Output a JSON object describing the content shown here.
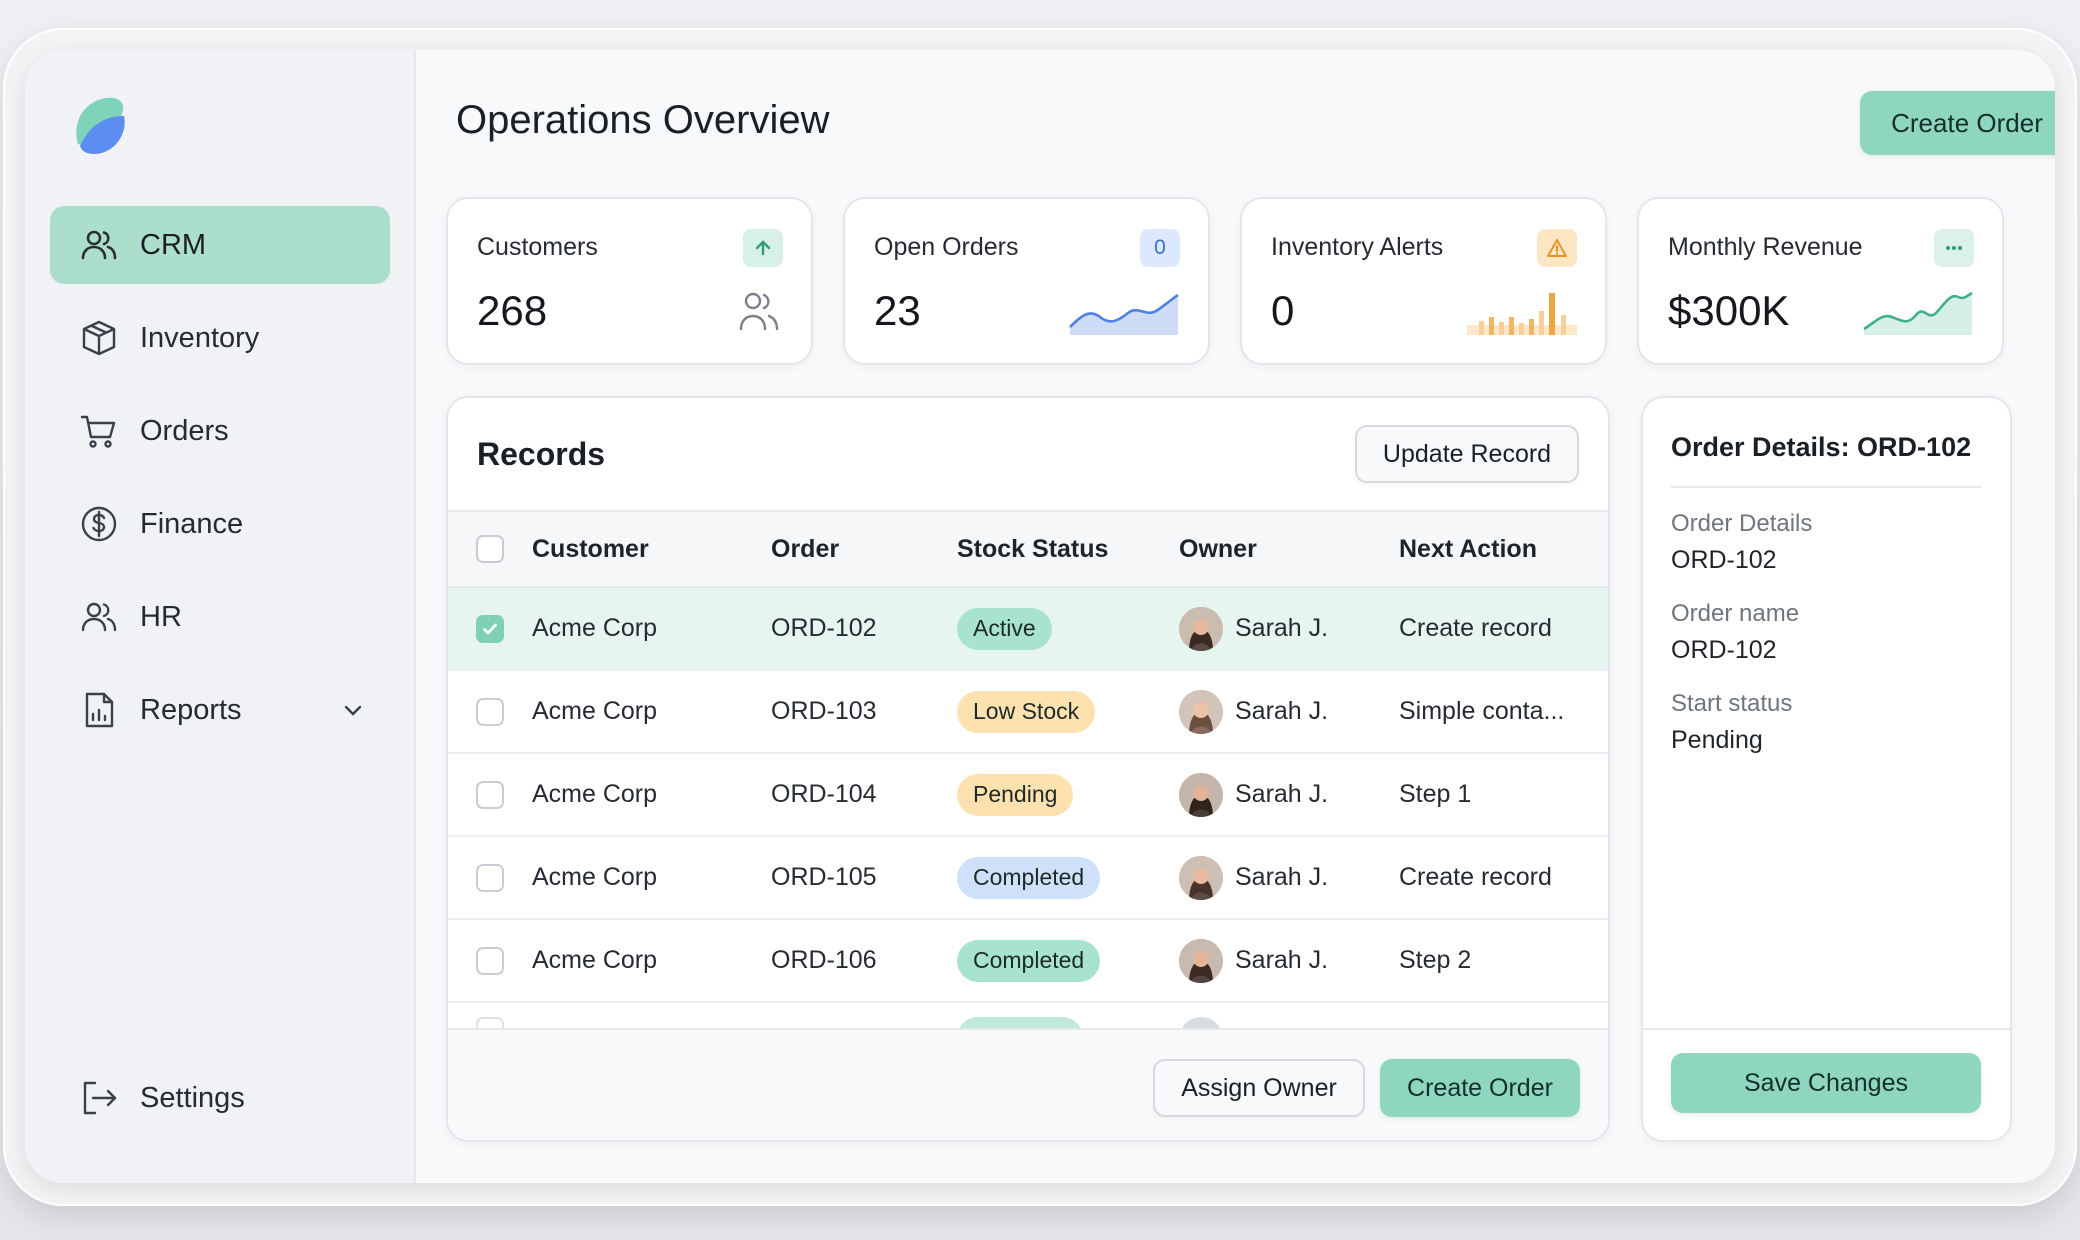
{
  "header": {
    "title": "Operations Overview",
    "create_order_label": "Create Order"
  },
  "sidebar": {
    "items": [
      {
        "label": "CRM",
        "icon": "users-icon",
        "active": true
      },
      {
        "label": "Inventory",
        "icon": "box-icon"
      },
      {
        "label": "Orders",
        "icon": "cart-icon"
      },
      {
        "label": "Finance",
        "icon": "dollar-icon"
      },
      {
        "label": "HR",
        "icon": "users-icon"
      },
      {
        "label": "Reports",
        "icon": "report-icon",
        "expandable": true
      }
    ],
    "settings_label": "Settings"
  },
  "kpis": [
    {
      "label": "Customers",
      "value": "268",
      "badge_icon": "arrow-up-icon"
    },
    {
      "label": "Open Orders",
      "value": "23",
      "badge_text": "0"
    },
    {
      "label": "Inventory Alerts",
      "value": "0",
      "badge_icon": "warning-icon"
    },
    {
      "label": "Monthly Revenue",
      "value": "$300K",
      "badge_icon": "more-icon"
    }
  ],
  "records": {
    "title": "Records",
    "update_label": "Update Record",
    "columns": [
      "Customer",
      "Order",
      "Stock Status",
      "Owner",
      "Next Action"
    ],
    "rows": [
      {
        "customer": "Acme Corp",
        "order": "ORD-102",
        "status": "Active",
        "owner": "Sarah J.",
        "next": "Create record",
        "checked": true
      },
      {
        "customer": "Acme Corp",
        "order": "ORD-103",
        "status": "Low Stock",
        "owner": "Sarah J.",
        "next": "Simple conta..."
      },
      {
        "customer": "Acme Corp",
        "order": "ORD-104",
        "status": "Pending",
        "owner": "Sarah J.",
        "next": "Step 1"
      },
      {
        "customer": "Acme Corp",
        "order": "ORD-105",
        "status": "Completed",
        "owner": "Sarah J.",
        "next": "Create record"
      },
      {
        "customer": "Acme Corp",
        "order": "ORD-106",
        "status": "Completed",
        "owner": "Sarah J.",
        "next": "Step 2"
      }
    ],
    "assign_label": "Assign Owner",
    "create_label": "Create Order"
  },
  "status_colors": {
    "Active": "#a8e3cf",
    "Low Stock": "#fde2b0",
    "Pending": "#fde2b0",
    "Completed": "#cfe0fb"
  },
  "details": {
    "title": "Order Details: ORD-102",
    "fields": [
      {
        "label": "Order Details",
        "value": "ORD-102"
      },
      {
        "label": "Order name",
        "value": "ORD-102"
      },
      {
        "label": "Start status",
        "value": "Pending"
      }
    ],
    "save_label": "Save Changes"
  },
  "colors": {
    "accent": "#8fd6c0",
    "active_nav": "#abdfcc"
  }
}
